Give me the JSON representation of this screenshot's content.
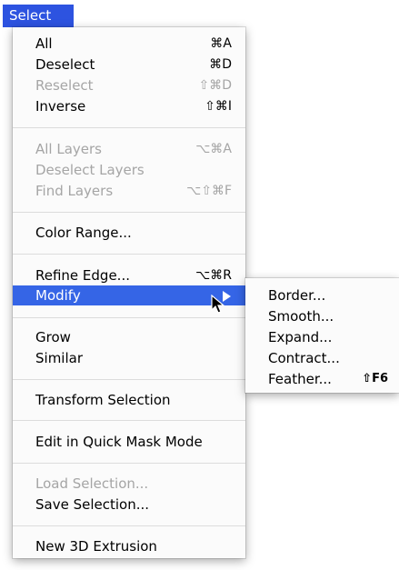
{
  "menubar": {
    "title": "Select"
  },
  "menu": {
    "items": [
      {
        "label": "All",
        "shortcut": "⌘A",
        "disabled": false
      },
      {
        "label": "Deselect",
        "shortcut": "⌘D",
        "disabled": false
      },
      {
        "label": "Reselect",
        "shortcut": "⇧⌘D",
        "disabled": true
      },
      {
        "label": "Inverse",
        "shortcut": "⇧⌘I",
        "disabled": false
      },
      {
        "label": "All Layers",
        "shortcut": "⌥⌘A",
        "disabled": true
      },
      {
        "label": "Deselect Layers",
        "shortcut": "",
        "disabled": true
      },
      {
        "label": "Find Layers",
        "shortcut": "⌥⇧⌘F",
        "disabled": true
      },
      {
        "label": "Color Range...",
        "shortcut": "",
        "disabled": false
      },
      {
        "label": "Refine Edge...",
        "shortcut": "⌥⌘R",
        "disabled": false
      },
      {
        "label": "Modify",
        "shortcut": "",
        "disabled": false,
        "highlighted": true,
        "has_submenu": true
      },
      {
        "label": "Grow",
        "shortcut": "",
        "disabled": false
      },
      {
        "label": "Similar",
        "shortcut": "",
        "disabled": false
      },
      {
        "label": "Transform Selection",
        "shortcut": "",
        "disabled": false
      },
      {
        "label": "Edit in Quick Mask Mode",
        "shortcut": "",
        "disabled": false
      },
      {
        "label": "Load Selection...",
        "shortcut": "",
        "disabled": true
      },
      {
        "label": "Save Selection...",
        "shortcut": "",
        "disabled": false
      },
      {
        "label": "New 3D Extrusion",
        "shortcut": "",
        "disabled": false
      }
    ]
  },
  "submenu": {
    "items": [
      {
        "label": "Border...",
        "shortcut": ""
      },
      {
        "label": "Smooth...",
        "shortcut": ""
      },
      {
        "label": "Expand...",
        "shortcut": ""
      },
      {
        "label": "Contract...",
        "shortcut": ""
      },
      {
        "label": "Feather...",
        "shortcut": "⇧F6"
      }
    ]
  },
  "colors": {
    "highlight": "#3565e6",
    "menubar_active": "#2d53e0",
    "disabled_text": "#a5a5a5"
  }
}
